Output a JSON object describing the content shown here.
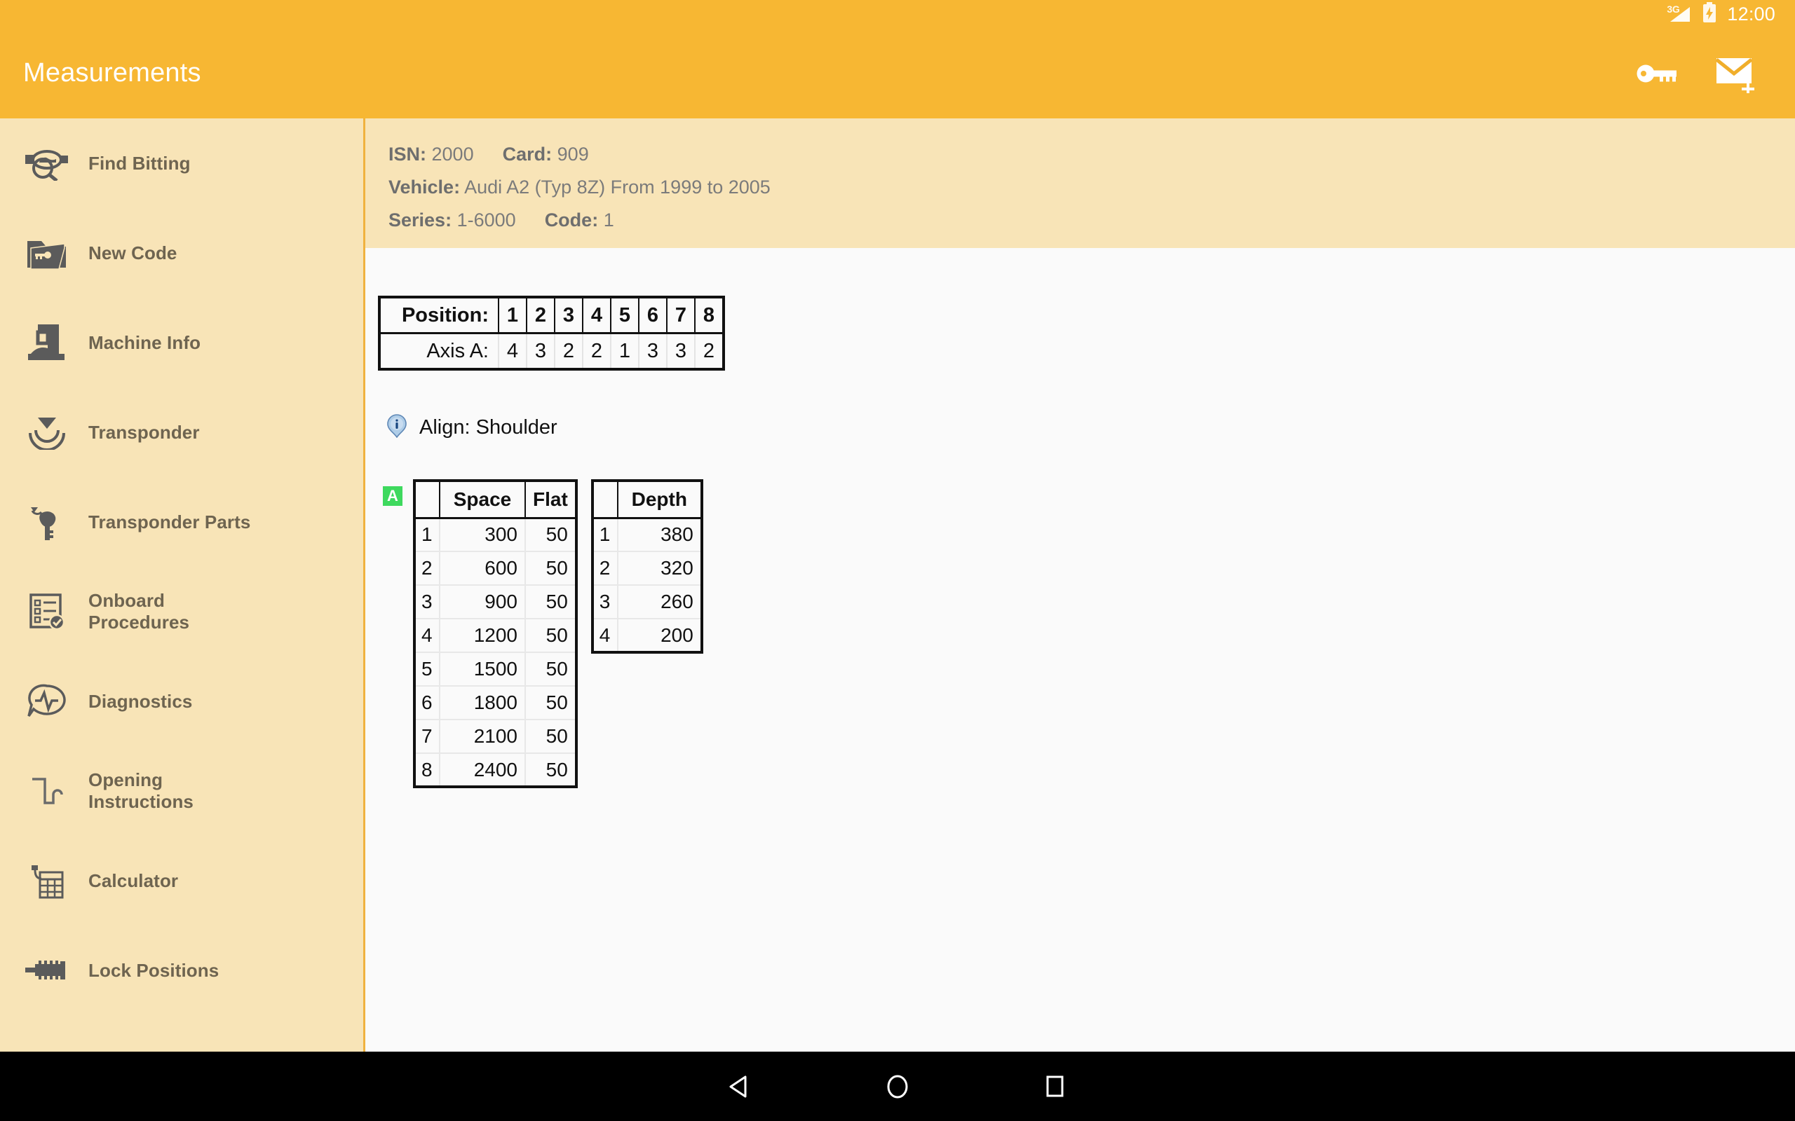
{
  "status_bar": {
    "network_label": "3G",
    "signal_icon": "signal-bars-icon",
    "battery_icon": "battery-charging-icon",
    "time": "12:00"
  },
  "app_bar": {
    "title": "Measurements",
    "actions": [
      {
        "name": "key-icon",
        "label": "Key"
      },
      {
        "name": "mail-add-icon",
        "label": "Add Mail"
      }
    ]
  },
  "sidebar": {
    "items": [
      {
        "label": "Find Bitting",
        "icon": "find-bitting-icon"
      },
      {
        "label": "New Code",
        "icon": "new-code-folder-key-icon"
      },
      {
        "label": "Machine Info",
        "icon": "machine-info-icon"
      },
      {
        "label": "Transponder",
        "icon": "transponder-signal-icon"
      },
      {
        "label": "Transponder Parts",
        "icon": "transponder-parts-key-icon"
      },
      {
        "label": "Onboard\nProcedures",
        "icon": "onboard-procedures-checklist-icon"
      },
      {
        "label": "Diagnostics",
        "icon": "diagnostics-pulse-icon"
      },
      {
        "label": "Opening\nInstructions",
        "icon": "opening-instructions-icon"
      },
      {
        "label": "Calculator",
        "icon": "calculator-icon"
      },
      {
        "label": "Lock Positions",
        "icon": "lock-positions-icon"
      }
    ]
  },
  "info_panel": {
    "isn_key": "ISN:",
    "isn_value": "2000",
    "card_key": "Card:",
    "card_value": "909",
    "vehicle_key": "Vehicle:",
    "vehicle_value": "Audi A2 (Typ 8Z) From 1999 to 2005",
    "series_key": "Series:",
    "series_value": "1-6000",
    "code_key": "Code:",
    "code_value": "1"
  },
  "position_table": {
    "position_label": "Position:",
    "positions": [
      "1",
      "2",
      "3",
      "4",
      "5",
      "6",
      "7",
      "8"
    ],
    "axis_label": "Axis A:",
    "axis_values": [
      "4",
      "3",
      "2",
      "2",
      "1",
      "3",
      "3",
      "2"
    ]
  },
  "align": {
    "icon": "info-balloon-icon",
    "text": "Align: Shoulder"
  },
  "measurements": {
    "badge": "A",
    "space_table": {
      "headers": [
        "",
        "Space",
        "Flat"
      ],
      "rows": [
        [
          "1",
          "300",
          "50"
        ],
        [
          "2",
          "600",
          "50"
        ],
        [
          "3",
          "900",
          "50"
        ],
        [
          "4",
          "1200",
          "50"
        ],
        [
          "5",
          "1500",
          "50"
        ],
        [
          "6",
          "1800",
          "50"
        ],
        [
          "7",
          "2100",
          "50"
        ],
        [
          "8",
          "2400",
          "50"
        ]
      ]
    },
    "depth_table": {
      "headers": [
        "",
        "Depth"
      ],
      "rows": [
        [
          "1",
          "380"
        ],
        [
          "2",
          "320"
        ],
        [
          "3",
          "260"
        ],
        [
          "4",
          "200"
        ]
      ]
    }
  },
  "nav_bar": {
    "buttons": [
      {
        "name": "back-button",
        "label": "Back"
      },
      {
        "name": "home-button",
        "label": "Home"
      },
      {
        "name": "recents-button",
        "label": "Recents"
      }
    ]
  },
  "colors": {
    "accent": "#F7B733",
    "sidebar_bg": "#F8E4B7",
    "sidebar_text": "#6E6450",
    "content_bg": "#FAFAFA",
    "badge_green": "#3ED95E",
    "divider": "#F0B23F"
  }
}
